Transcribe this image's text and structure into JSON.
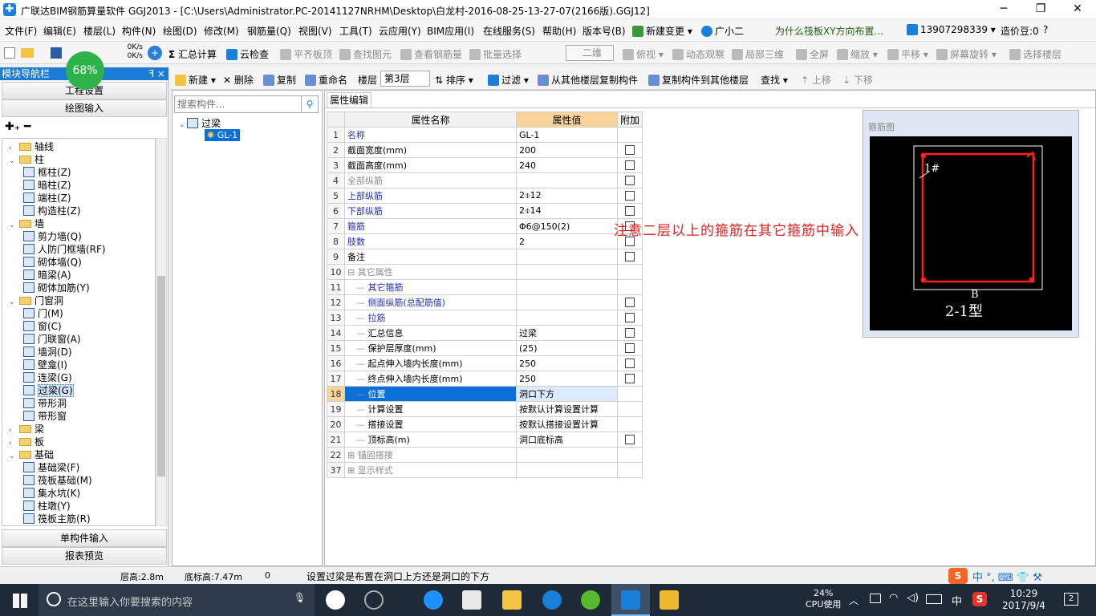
{
  "window": {
    "title": "广联达BIM钢筋算量软件 GGJ2013 - [C:\\Users\\Administrator.PC-20141127NRHM\\Desktop\\白龙村-2016-08-25-13-27-07(2166版).GGJ12]",
    "minimize": "─",
    "maximize": "❐",
    "close": "✕"
  },
  "menu": [
    "文件(F)",
    "编辑(E)",
    "楼层(L)",
    "构件(N)",
    "绘图(D)",
    "修改(M)",
    "钢筋量(Q)",
    "视图(V)",
    "工具(T)",
    "云应用(Y)",
    "BIM应用(I)",
    "在线服务(S)",
    "帮助(H)",
    "版本号(B)",
    "新建变更 ▾",
    "广小二",
    "为什么筏板XY方向布置...",
    "13907298339 ▾",
    "造价豆:0"
  ],
  "speed": {
    "percent": "68%",
    "up": "0K/s",
    "down": "0K/s"
  },
  "toolbar1": {
    "items": [
      "汇总计算",
      "云检查",
      "平齐板顶",
      "查找图元",
      "查看钢筋量",
      "批量选择",
      "二维",
      "俯视 ▾",
      "动态观察",
      "局部三维",
      "全屏",
      "缩放 ▾",
      "平移 ▾",
      "屏幕旋转 ▾",
      "选择楼层"
    ]
  },
  "toolbar2": {
    "items": [
      "新建 ▾",
      "删除",
      "复制",
      "重命名",
      "楼层",
      "第3层",
      "排序 ▾",
      "过滤 ▾",
      "从其他楼层复制构件",
      "复制构件到其他楼层",
      "查找 ▾",
      "上移",
      "下移"
    ]
  },
  "leftpanel": {
    "title": "模块导航栏",
    "pin": "ꟻ ×",
    "buttons": [
      "工程设置",
      "绘图输入"
    ],
    "bottom_buttons": [
      "单构件输入",
      "报表预览"
    ],
    "tree": [
      {
        "lvl": 0,
        "exp": "›",
        "label": "轴线",
        "type": "folder"
      },
      {
        "lvl": 0,
        "exp": "⌄",
        "label": "柱",
        "type": "folder"
      },
      {
        "lvl": 1,
        "label": "框柱(Z)"
      },
      {
        "lvl": 1,
        "label": "暗柱(Z)"
      },
      {
        "lvl": 1,
        "label": "端柱(Z)"
      },
      {
        "lvl": 1,
        "label": "构造柱(Z)"
      },
      {
        "lvl": 0,
        "exp": "⌄",
        "label": "墙",
        "type": "folder"
      },
      {
        "lvl": 1,
        "label": "剪力墙(Q)"
      },
      {
        "lvl": 1,
        "label": "人防门框墙(RF)"
      },
      {
        "lvl": 1,
        "label": "砌体墙(Q)"
      },
      {
        "lvl": 1,
        "label": "暗梁(A)"
      },
      {
        "lvl": 1,
        "label": "砌体加筋(Y)"
      },
      {
        "lvl": 0,
        "exp": "⌄",
        "label": "门窗洞",
        "type": "folder"
      },
      {
        "lvl": 1,
        "label": "门(M)"
      },
      {
        "lvl": 1,
        "label": "窗(C)"
      },
      {
        "lvl": 1,
        "label": "门联窗(A)"
      },
      {
        "lvl": 1,
        "label": "墙洞(D)"
      },
      {
        "lvl": 1,
        "label": "壁龛(I)"
      },
      {
        "lvl": 1,
        "label": "连梁(G)"
      },
      {
        "lvl": 1,
        "label": "过梁(G)",
        "selected": true
      },
      {
        "lvl": 1,
        "label": "带形洞"
      },
      {
        "lvl": 1,
        "label": "带形窗"
      },
      {
        "lvl": 0,
        "exp": "›",
        "label": "梁",
        "type": "folder"
      },
      {
        "lvl": 0,
        "exp": "›",
        "label": "板",
        "type": "folder"
      },
      {
        "lvl": 0,
        "exp": "⌄",
        "label": "基础",
        "type": "folder"
      },
      {
        "lvl": 1,
        "label": "基础梁(F)"
      },
      {
        "lvl": 1,
        "label": "筏板基础(M)"
      },
      {
        "lvl": 1,
        "label": "集水坑(K)"
      },
      {
        "lvl": 1,
        "label": "柱墩(Y)"
      },
      {
        "lvl": 1,
        "label": "筏板主筋(R)"
      }
    ]
  },
  "midpanel": {
    "search_placeholder": "搜索构件...",
    "root": "过梁",
    "child": "GL-1"
  },
  "props": {
    "tab": "属性编辑",
    "headers": [
      "属性名称",
      "属性值",
      "附加"
    ],
    "rows": [
      {
        "n": "1",
        "name": "名称",
        "val": "GL-1",
        "cls": "blue",
        "cb": false
      },
      {
        "n": "2",
        "name": "截面宽度(mm)",
        "val": "200",
        "cls": "",
        "cb": true
      },
      {
        "n": "3",
        "name": "截面高度(mm)",
        "val": "240",
        "cls": "",
        "cb": true
      },
      {
        "n": "4",
        "name": "全部纵筋",
        "val": "",
        "cls": "gray",
        "cb": true
      },
      {
        "n": "5",
        "name": "上部纵筋",
        "val": "2⌽12",
        "cls": "blue",
        "cb": true
      },
      {
        "n": "6",
        "name": "下部纵筋",
        "val": "2⌽14",
        "cls": "blue",
        "cb": true
      },
      {
        "n": "7",
        "name": "箍筋",
        "val": "Φ6@150(2)",
        "cls": "blue",
        "cb": true
      },
      {
        "n": "8",
        "name": "肢数",
        "val": "2",
        "cls": "blue",
        "cb": true
      },
      {
        "n": "9",
        "name": "备注",
        "val": "",
        "cls": "",
        "cb": true
      },
      {
        "n": "10",
        "name": "⊟ 其它属性",
        "val": "",
        "cls": "gray",
        "cb": false,
        "group": true
      },
      {
        "n": "11",
        "name": "其它箍筋",
        "val": "",
        "cls": "blue",
        "cb": false,
        "indent": true
      },
      {
        "n": "12",
        "name": "侧面纵筋(总配筋值)",
        "val": "",
        "cls": "blue",
        "cb": true,
        "indent": true
      },
      {
        "n": "13",
        "name": "拉筋",
        "val": "",
        "cls": "blue",
        "cb": true,
        "indent": true
      },
      {
        "n": "14",
        "name": "汇总信息",
        "val": "过梁",
        "cls": "",
        "cb": true,
        "indent": true
      },
      {
        "n": "15",
        "name": "保护层厚度(mm)",
        "val": "(25)",
        "cls": "",
        "cb": true,
        "indent": true
      },
      {
        "n": "16",
        "name": "起点伸入墙内长度(mm)",
        "val": "250",
        "cls": "",
        "cb": true,
        "indent": true
      },
      {
        "n": "17",
        "name": "终点伸入墙内长度(mm)",
        "val": "250",
        "cls": "",
        "cb": true,
        "indent": true
      },
      {
        "n": "18",
        "name": "位置",
        "val": "洞口下方",
        "cls": "",
        "cb": false,
        "indent": true,
        "sel": true
      },
      {
        "n": "19",
        "name": "计算设置",
        "val": "按默认计算设置计算",
        "cls": "",
        "cb": false,
        "indent": true
      },
      {
        "n": "20",
        "name": "搭接设置",
        "val": "按默认搭接设置计算",
        "cls": "",
        "cb": false,
        "indent": true
      },
      {
        "n": "21",
        "name": "顶标高(m)",
        "val": "洞口底标高",
        "cls": "",
        "cb": true,
        "indent": true
      },
      {
        "n": "22",
        "name": "⊞ 锚固搭接",
        "val": "",
        "cls": "gray",
        "cb": false,
        "group": true
      },
      {
        "n": "37",
        "name": "⊞ 显示样式",
        "val": "",
        "cls": "gray",
        "cb": false,
        "group": true
      }
    ]
  },
  "annotation": "注意二层以上的箍筋在其它箍筋中输入",
  "rebar_view": {
    "title": "箍筋图",
    "label_1": "1#",
    "label_b": "B",
    "caption": "2-1型"
  },
  "status": {
    "floor_height": "层高:2.8m",
    "base_elev": "底标高:7.47m",
    "zero": "0",
    "hint": "设置过梁是布置在洞口上方还是洞口的下方"
  },
  "ime": "中 °, ⌨ 👕 ⚒",
  "taskbar": {
    "search_placeholder": "在这里输入你要搜索的内容",
    "cpu": "24%",
    "cpu_label": "CPU使用",
    "lang": "中",
    "time": "10:29",
    "date": "2017/9/4",
    "notif": "2"
  }
}
